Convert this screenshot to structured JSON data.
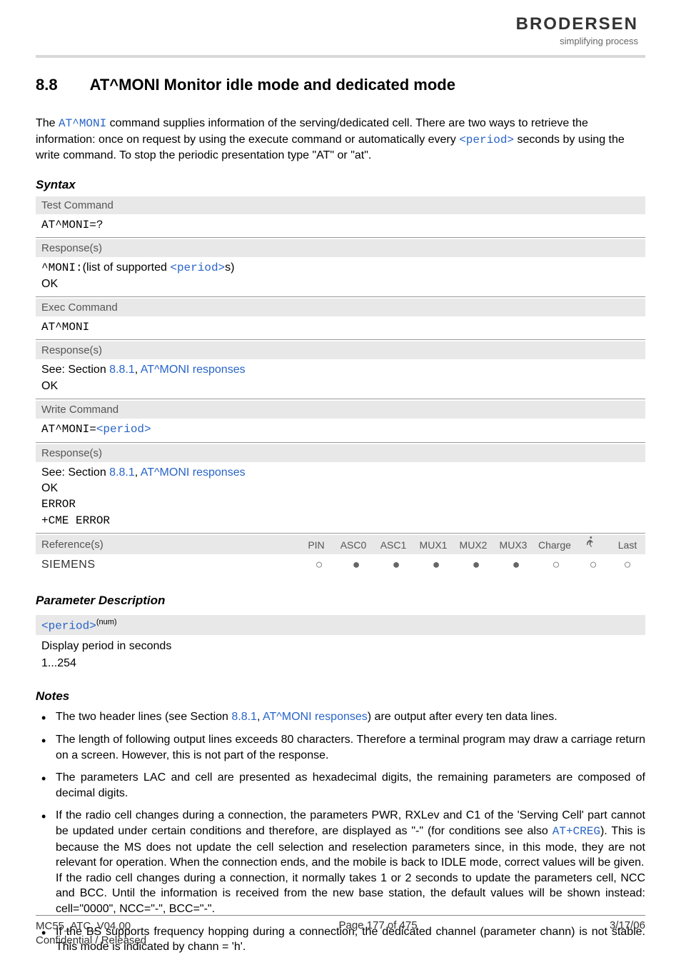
{
  "header": {
    "brand": "BRODERSEN",
    "tagline": "simplifying process"
  },
  "title": {
    "number": "8.8",
    "text": "AT^MONI   Monitor idle mode and dedicated mode"
  },
  "intro": {
    "pre": "The ",
    "cmd": "AT^MONI",
    "mid": " command supplies information of the serving/dedicated cell. There are two ways to retrieve the information: once on request by using the execute command or automatically every ",
    "param": "<period>",
    "post": " seconds by using the write command. To stop the periodic presentation type \"AT\" or \"at\"."
  },
  "syntax_heading": "Syntax",
  "test_cmd": {
    "label": "Test Command",
    "cmd": "AT^MONI=?",
    "resp_label": "Response(s)",
    "resp_prefix": "^MONI:",
    "resp_text1": "(list of supported ",
    "resp_param": "<period>",
    "resp_text2": "s)",
    "ok": "OK"
  },
  "exec_cmd": {
    "label": "Exec Command",
    "cmd": "AT^MONI",
    "resp_label": "Response(s)",
    "see": "See: Section ",
    "link1": "8.8.1",
    "sep": ", ",
    "link2": "AT^MONI responses",
    "ok": "OK"
  },
  "write_cmd": {
    "label": "Write Command",
    "cmd_prefix": "AT^MONI=",
    "cmd_param": "<period>",
    "resp_label": "Response(s)",
    "see": "See: Section ",
    "link1": "8.8.1",
    "sep": ", ",
    "link2": "AT^MONI responses",
    "ok": "OK",
    "error": "ERROR",
    "cme": "+CME ERROR"
  },
  "ref": {
    "label": "Reference(s)",
    "cols": [
      "PIN",
      "ASC0",
      "ASC1",
      "MUX1",
      "MUX2",
      "MUX3",
      "Charge",
      "",
      "Last"
    ],
    "siemens": "SIEMENS",
    "dots": [
      "empty",
      "filled",
      "filled",
      "filled",
      "filled",
      "filled",
      "empty",
      "empty",
      "empty"
    ]
  },
  "param_heading": "Parameter Description",
  "param": {
    "name": "<period>",
    "sup": "(num)",
    "desc": "Display period in seconds",
    "range": "1...254"
  },
  "notes_heading": "Notes",
  "notes": [
    {
      "pre": "The two header lines (see Section ",
      "link1": "8.8.1",
      "sep": ", ",
      "link2": "AT^MONI responses",
      "post": ") are output after every ten data lines."
    },
    {
      "text": "The length of following output lines exceeds 80 characters. Therefore a terminal program may draw a carriage return on a screen. However, this is not part of the response."
    },
    {
      "text": "The parameters LAC and cell are presented as hexadecimal digits, the remaining parameters are composed of decimal digits."
    },
    {
      "pre": "If the radio cell changes during a connection, the parameters PWR, RXLev and C1 of the 'Serving Cell' part cannot be updated under certain conditions and therefore, are displayed as \"-\" (for conditions see also ",
      "link": "AT+CREG",
      "post": "). This is because the MS does not update the cell selection and reselection parameters since, in this mode, they are not relevant for operation. When the connection ends, and the mobile is back to IDLE mode, correct values will be given.",
      "post2": "If the radio cell changes during a connection, it normally takes 1 or 2 seconds to update the parameters cell, NCC and BCC. Until the information is received from the new base station, the default values will be shown instead: cell=\"0000\", NCC=\"-\", BCC=\"-\"."
    },
    {
      "text": "If the BS supports frequency hopping during a connection, the dedicated channel (parameter chann) is not stable. This mode is indicated by chann = 'h'."
    }
  ],
  "footer": {
    "doc": "MC55_ATC_V04.00",
    "conf": "Confidential / Released",
    "page": "Page 177 of 475",
    "date": "3/17/06"
  }
}
